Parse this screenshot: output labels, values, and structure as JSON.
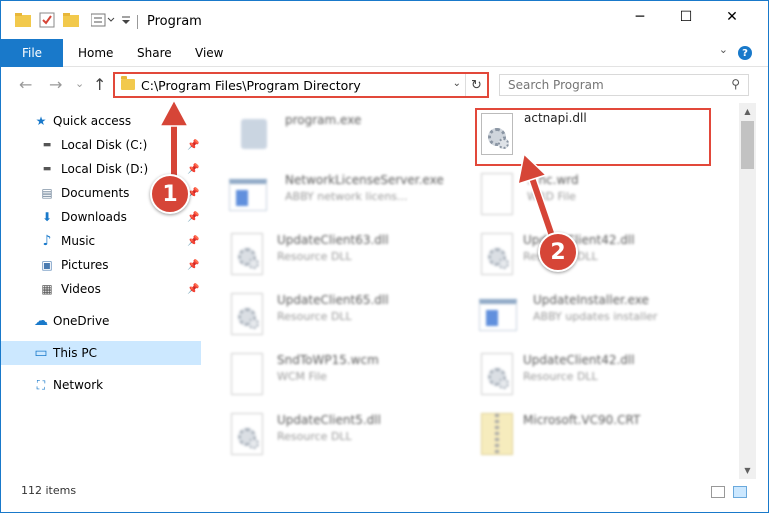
{
  "window": {
    "title": "Program",
    "minimize_icon": "─",
    "maximize_icon": "☐",
    "close_icon": "✕"
  },
  "ribbon": {
    "tabs": [
      {
        "label": "File"
      },
      {
        "label": "Home"
      },
      {
        "label": "Share"
      },
      {
        "label": "View"
      }
    ],
    "help_label": "?",
    "collapse_icon": "⌄"
  },
  "nav": {
    "back_icon": "←",
    "forward_icon": "→",
    "recent_icon": "⌄",
    "up_icon": "↑"
  },
  "address": {
    "path": "C:\\Program Files\\Program Directory",
    "dropdown_icon": "⌄",
    "refresh_icon": "↻"
  },
  "search": {
    "placeholder": "Search Program",
    "icon": "⚲"
  },
  "sidebar": {
    "items": [
      {
        "label": "Quick access",
        "icon": "★"
      },
      {
        "label": "Local Disk (C:)",
        "icon": "▬"
      },
      {
        "label": "Local Disk (D:)",
        "icon": "▬"
      },
      {
        "label": "Documents",
        "icon": "▤"
      },
      {
        "label": "Downloads",
        "icon": "⬇"
      },
      {
        "label": "Music",
        "icon": "♪"
      },
      {
        "label": "Pictures",
        "icon": "▣"
      },
      {
        "label": "Videos",
        "icon": "▦"
      },
      {
        "label": "OneDrive",
        "icon": "☁"
      },
      {
        "label": "This PC",
        "icon": "▭"
      },
      {
        "label": "Network",
        "icon": "⛶"
      }
    ],
    "pin_icon": "📌"
  },
  "files": [
    {
      "name": "program.exe",
      "type": ""
    },
    {
      "name": "actnapi.dll",
      "type": ""
    },
    {
      "name": "NetworkLicenseServer.exe",
      "type": "ABBY network licens..."
    },
    {
      "name": "...nc.wrd",
      "type": "WRD File"
    },
    {
      "name": "UpdateClient63.dll",
      "type": "Resource DLL"
    },
    {
      "name": "UpdateClient42.dll",
      "type": "Resource DLL"
    },
    {
      "name": "UpdateClient65.dll",
      "type": "Resource DLL"
    },
    {
      "name": "UpdateInstaller.exe",
      "type": "ABBY updates installer"
    },
    {
      "name": "SndToWP15.wcm",
      "type": "WCM File"
    },
    {
      "name": "UpdateClient42.dll",
      "type": "Resource DLL"
    },
    {
      "name": "UpdateClient5.dll",
      "type": "Resource DLL"
    },
    {
      "name": "Microsoft.VC90.CRT",
      "type": ""
    }
  ],
  "status": {
    "count": "112 items"
  },
  "annotations": {
    "callout_1": "1",
    "callout_2": "2"
  },
  "colors": {
    "accent": "#1979ca",
    "highlight": "#e2483a",
    "selected": "#cce8ff"
  }
}
